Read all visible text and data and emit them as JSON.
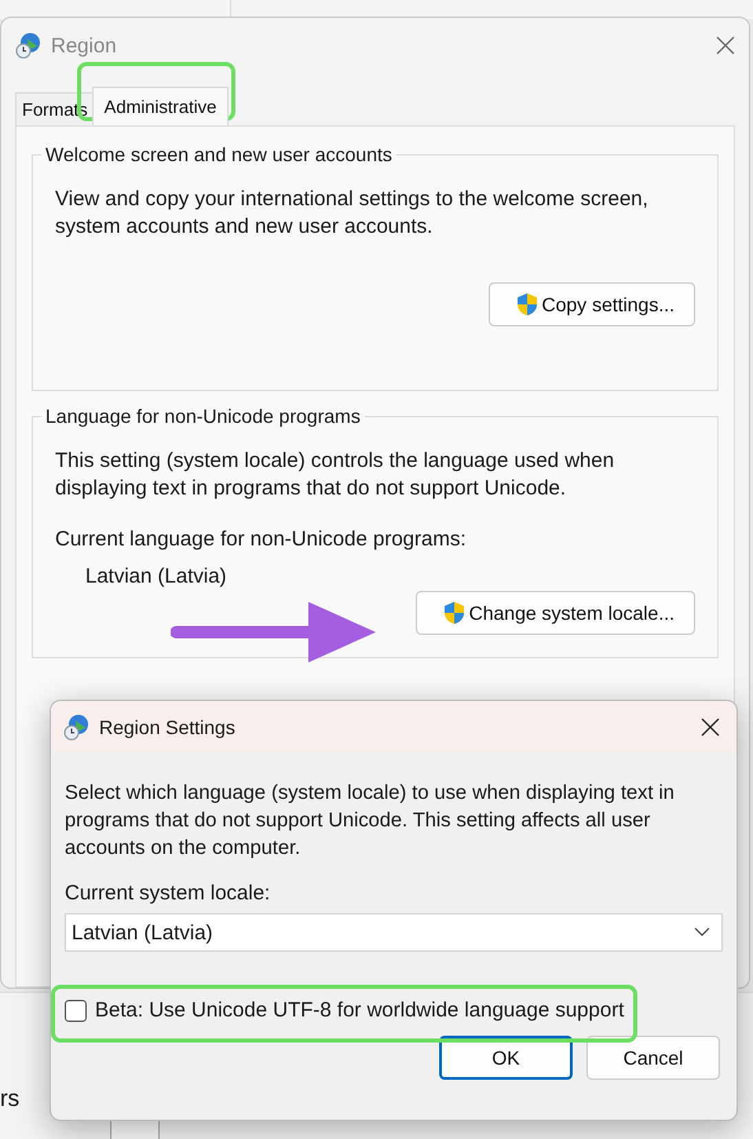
{
  "background": {
    "fragment": "rs"
  },
  "window": {
    "title": "Region",
    "tabs": [
      {
        "label": "Formats",
        "selected": false
      },
      {
        "label": "Administrative",
        "selected": true
      }
    ],
    "groups": [
      {
        "title": "Welcome screen and new user accounts",
        "description": "View and copy your international settings to the welcome screen, system accounts and new user accounts.",
        "button": "Copy settings..."
      },
      {
        "title": "Language for non-Unicode programs",
        "description": "This setting (system locale) controls the language used when displaying text in programs that do not support Unicode.",
        "current_label": "Current language for non-Unicode programs:",
        "current_value": "Latvian (Latvia)",
        "button": "Change system locale..."
      }
    ]
  },
  "dialog": {
    "title": "Region Settings",
    "description": "Select which language (system locale) to use when displaying text in programs that do not support Unicode. This setting affects all user accounts on the computer.",
    "locale_label": "Current system locale:",
    "locale_value": "Latvian (Latvia)",
    "checkbox": {
      "label": "Beta: Use Unicode UTF-8 for worldwide language support",
      "checked": false
    },
    "buttons": [
      {
        "label": "OK",
        "default": true
      },
      {
        "label": "Cancel",
        "default": false
      }
    ]
  }
}
